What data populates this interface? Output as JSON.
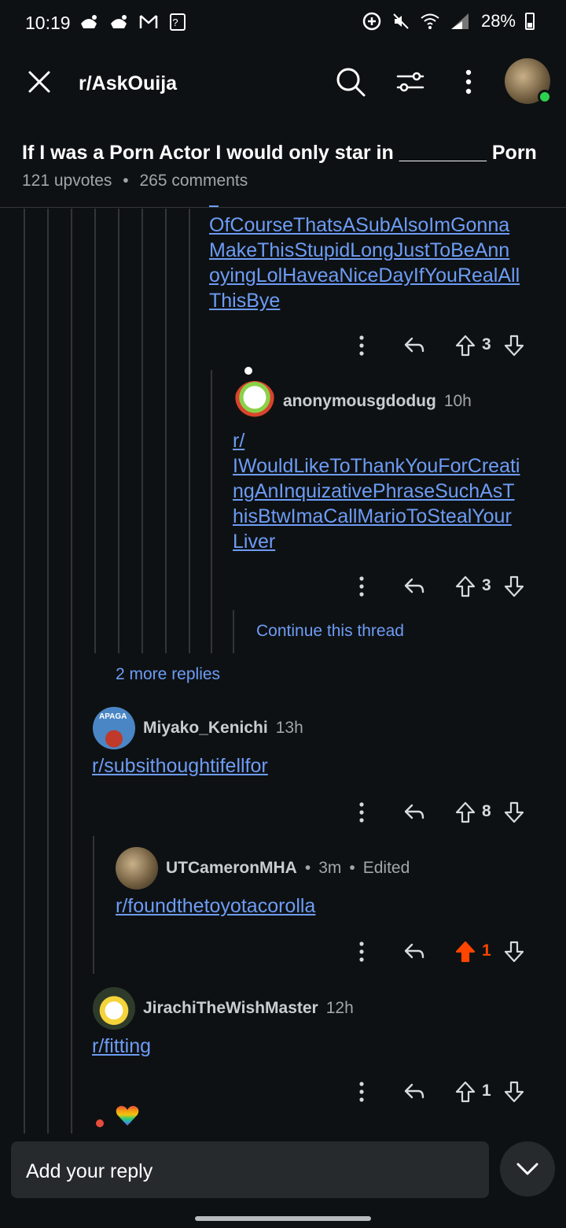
{
  "status_bar": {
    "time": "10:19",
    "notification_icons": [
      "rocket-icon",
      "rocket-icon",
      "gmail-icon",
      "question-icon"
    ],
    "right_icons": [
      "data-saver-icon",
      "mute-icon",
      "wifi-icon",
      "signal-icon"
    ],
    "battery": "28%"
  },
  "header": {
    "subreddit": "r/AskOuija",
    "icons": [
      "close-icon",
      "search-icon",
      "sort-icon",
      "more-vertical-icon",
      "user-avatar"
    ]
  },
  "post": {
    "title": "If I was a Porn Actor I would only star in ________ Porn",
    "upvotes": "121 upvotes",
    "separator": "•",
    "comments": "265 comments"
  },
  "comments": [
    {
      "id": "c1",
      "body_lines": [
        "OfCourseThatsASubAlsoImGonna",
        "MakeThisStupidLongJustToBeAnn",
        "oyingLolHaveaNiceDayIfYouRealAll",
        "ThisBye"
      ],
      "score": "3"
    },
    {
      "id": "c2",
      "author": "anonymousgdodug",
      "time": "10h",
      "body_lines": [
        "r/",
        "IWouldLikeToThankYouForCreati",
        "ngAnInquizativePhraseSuchAsT",
        "hisBtwImaCallMarioToStealYour",
        "Liver"
      ],
      "score": "3"
    },
    {
      "id": "c3",
      "author": "Miyako_Kenichi",
      "time": "13h",
      "avatar_label": "APAGA",
      "body": "r/subsithoughtifellfor",
      "score": "8"
    },
    {
      "id": "c4",
      "author": "UTCameronMHA",
      "dot1": "•",
      "time": "3m",
      "dot2": "•",
      "edited": "Edited",
      "body": "r/foundthetoyotacorolla",
      "score": "1",
      "upvoted": true
    },
    {
      "id": "c5",
      "author": "JirachiTheWishMaster",
      "time": "12h",
      "body": "r/fitting",
      "score": "1"
    }
  ],
  "thread_links": {
    "continue": "Continue this thread",
    "more_replies": "2 more replies"
  },
  "reply_bar": {
    "placeholder": "Add your reply"
  },
  "colors": {
    "background": "#0e1113",
    "link": "#6d9cf5",
    "upvote_active": "#ff4500",
    "online": "#2bd14f"
  }
}
